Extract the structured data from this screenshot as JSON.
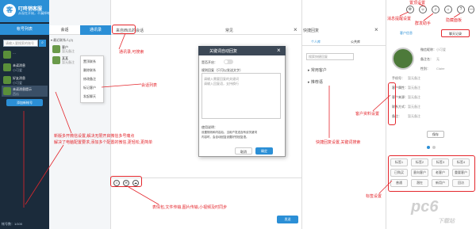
{
  "app": {
    "name": "叮咚销客服",
    "subtitle": "从现在开始，不漏掉每位客户的每个声音",
    "logo": "客",
    "accounts_tab": "帐号列表",
    "search_placeholder": "请输入要搜索的账号",
    "search_icon": "search-icon",
    "accounts": [
      {
        "name": "…",
        "sub": "…"
      },
      {
        "name": "未读消息",
        "sub": "小可爱"
      },
      {
        "name": "好友消息",
        "sub": "小可爱"
      },
      {
        "name": "未读消息提示",
        "sub": "西瓜"
      }
    ],
    "add_account": "添加新帐号",
    "footer": "帐号数：1/100"
  },
  "contacts": {
    "tabs": [
      "会话",
      "通讯录"
    ],
    "group": "▾ 最近联系人(2)",
    "items": [
      {
        "name": "客户",
        "sub": "暂无备注"
      },
      {
        "name": "某某",
        "sub": "暂无备注"
      }
    ],
    "menu": [
      "置顶联系",
      "删除联系",
      "修改备注",
      "标记客户",
      "发起聊天"
    ]
  },
  "chat": {
    "title": "来自西瓜的会话",
    "mid": "常见",
    "close": "×",
    "tools": [
      "☺",
      "✉",
      "☁"
    ],
    "send": "发送(Ctrl+Enter)"
  },
  "dialog": {
    "title": "关键词自动回复",
    "close": "×",
    "enable_label": "是否开启：",
    "reply_label": "规则回复（只可以发送文字）",
    "area_line1": "请输入需要回复的关键词",
    "area_line2": "请输入回复语，支持换行",
    "help_title": "使用说明：",
    "help_line1": "设置规则和内容后，当用户发送含有该关键词",
    "help_line2": "内容时，会自动回复设置好的回复语。",
    "btn_cancel": "取消",
    "btn_ok": "确定"
  },
  "phrases": {
    "header": "快捷回复",
    "close": "×",
    "tabs": [
      "个人库",
      "公共库"
    ],
    "search_placeholder": "搜索快捷回复",
    "groups": [
      "▸ 常用客户",
      "▸ 推荐语"
    ]
  },
  "profile": {
    "top_icons": [
      "⚙",
      "☺",
      "♫",
      "⌂",
      "?",
      "—"
    ],
    "tabs": [
      "客户信息",
      "聊天记录"
    ],
    "fields": [
      {
        "k": "微信昵称：",
        "v": "小可爱"
      },
      {
        "k": "备注名：",
        "v": "无"
      },
      {
        "k": "性别：",
        "v": "Claire"
      },
      {
        "k": "手机号：",
        "v": "暂无备注"
      },
      {
        "k": "客户属性：",
        "v": "暂无备注"
      },
      {
        "k": "客户来源：",
        "v": "暂无备注"
      },
      {
        "k": "联系方式：",
        "v": "暂无备注"
      },
      {
        "k": "备注：",
        "v": "暂无备注"
      }
    ],
    "save": "保存",
    "tags": [
      "标签1",
      "标签2",
      "标签3",
      "标签4",
      "已购买",
      "意向客户",
      "老客户",
      "重要客户",
      "普通",
      "潜在",
      "新用户",
      "回访"
    ]
  },
  "annotations": {
    "top_settings": "置顶设置",
    "msg_reminder": "消息提醒设置",
    "group_helper": "群发助手",
    "hide_panel": "隐藏面板",
    "address_book": "通讯录,可搜索",
    "session_list": "会话列表",
    "multi_open": "新版多开微信设置,解决无限开启微信多号痛点",
    "multi_open2": "解决了电脑配置要求,添加多个配置的微信,更轻松,更简单",
    "customer_info": "客户资料设置",
    "quick_reply": "快捷回复设置,关键词搜索",
    "tag_setting": "标签设置",
    "toolbar": "表情包,文件传输,图片传输,小视频及时同步"
  },
  "watermark": {
    "main": "pc6",
    "sub": "下载站"
  },
  "colors": {
    "accent": "#2b8fd6",
    "annotation": "#e4262c",
    "sidebar": "#1b2b3b"
  }
}
